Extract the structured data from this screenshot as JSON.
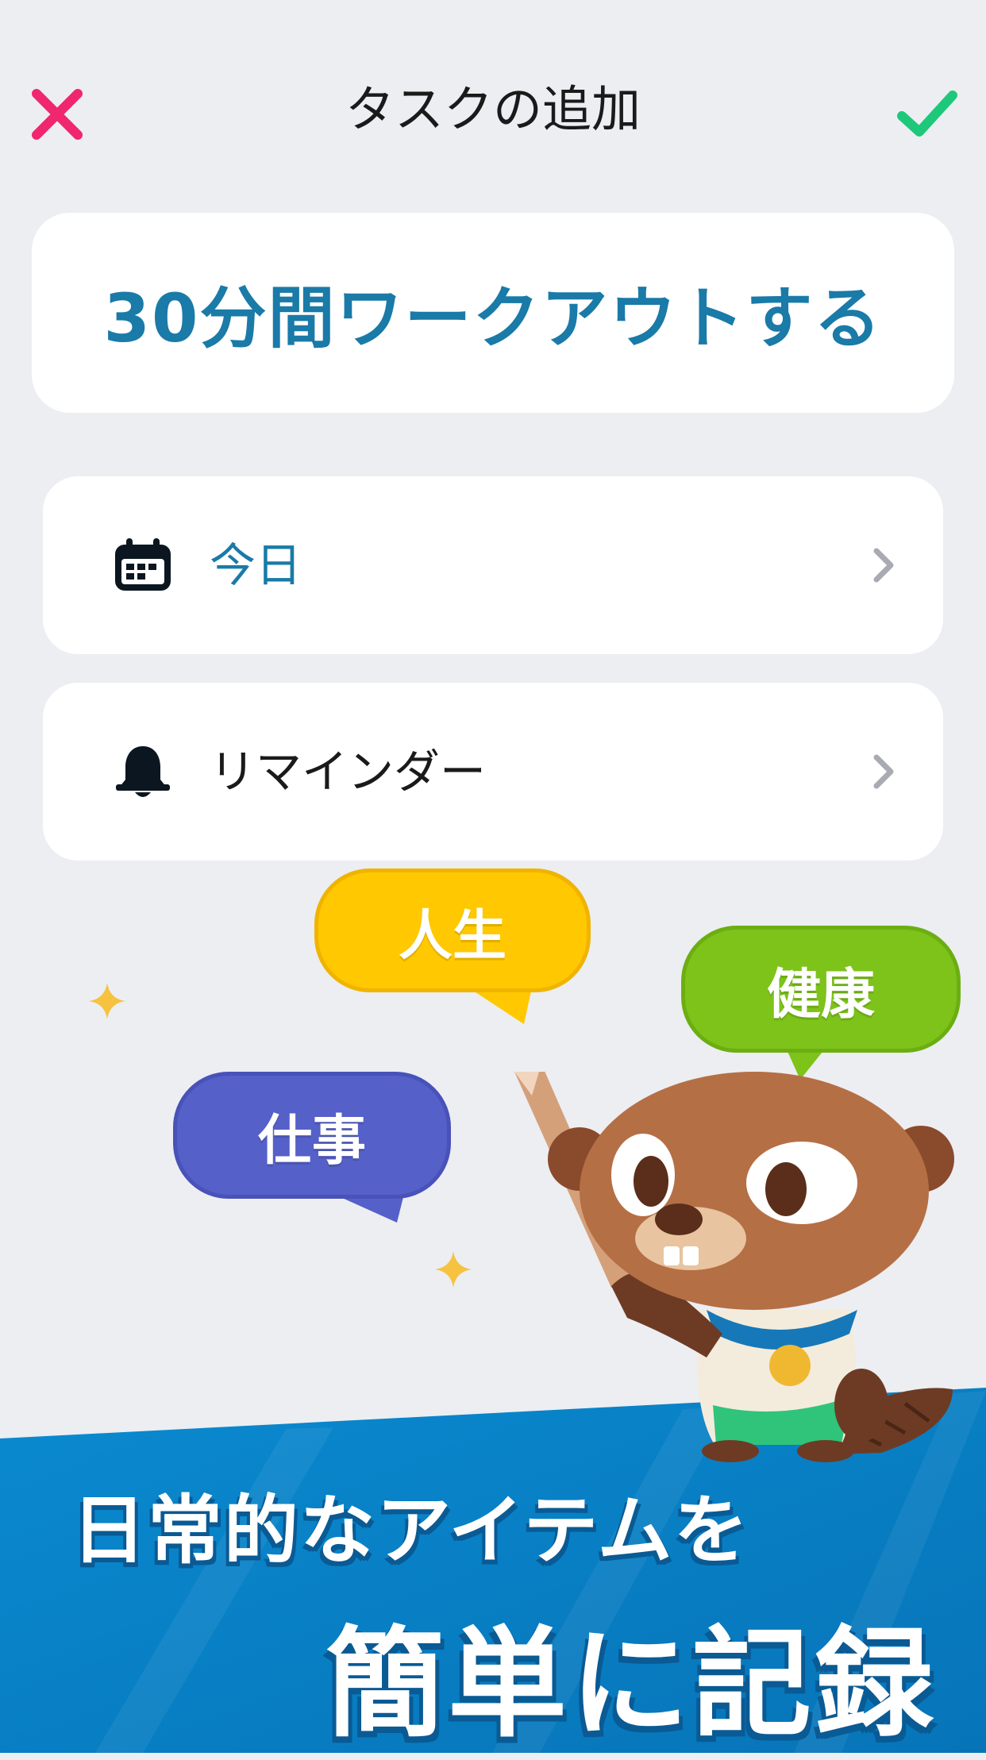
{
  "header": {
    "title": "タスクの追加",
    "close_icon": "close-icon",
    "confirm_icon": "check-icon",
    "close_color": "#f0266e",
    "confirm_color": "#1ec87a"
  },
  "task": {
    "name": "30分間ワークアウトする"
  },
  "options": [
    {
      "icon": "calendar-icon",
      "label": "今日"
    },
    {
      "icon": "bell-icon",
      "label": "リマインダー"
    }
  ],
  "categories": [
    {
      "label": "人生",
      "color": "#ffc800"
    },
    {
      "label": "健康",
      "color": "#7dc31a"
    },
    {
      "label": "仕事",
      "color": "#5560c8"
    }
  ],
  "promo": {
    "line1": "日常的なアイテムを",
    "line2": "簡単に記録"
  },
  "colors": {
    "accent": "#1a7aa8",
    "banner": "#0a88cc",
    "background": "#eceef2"
  }
}
